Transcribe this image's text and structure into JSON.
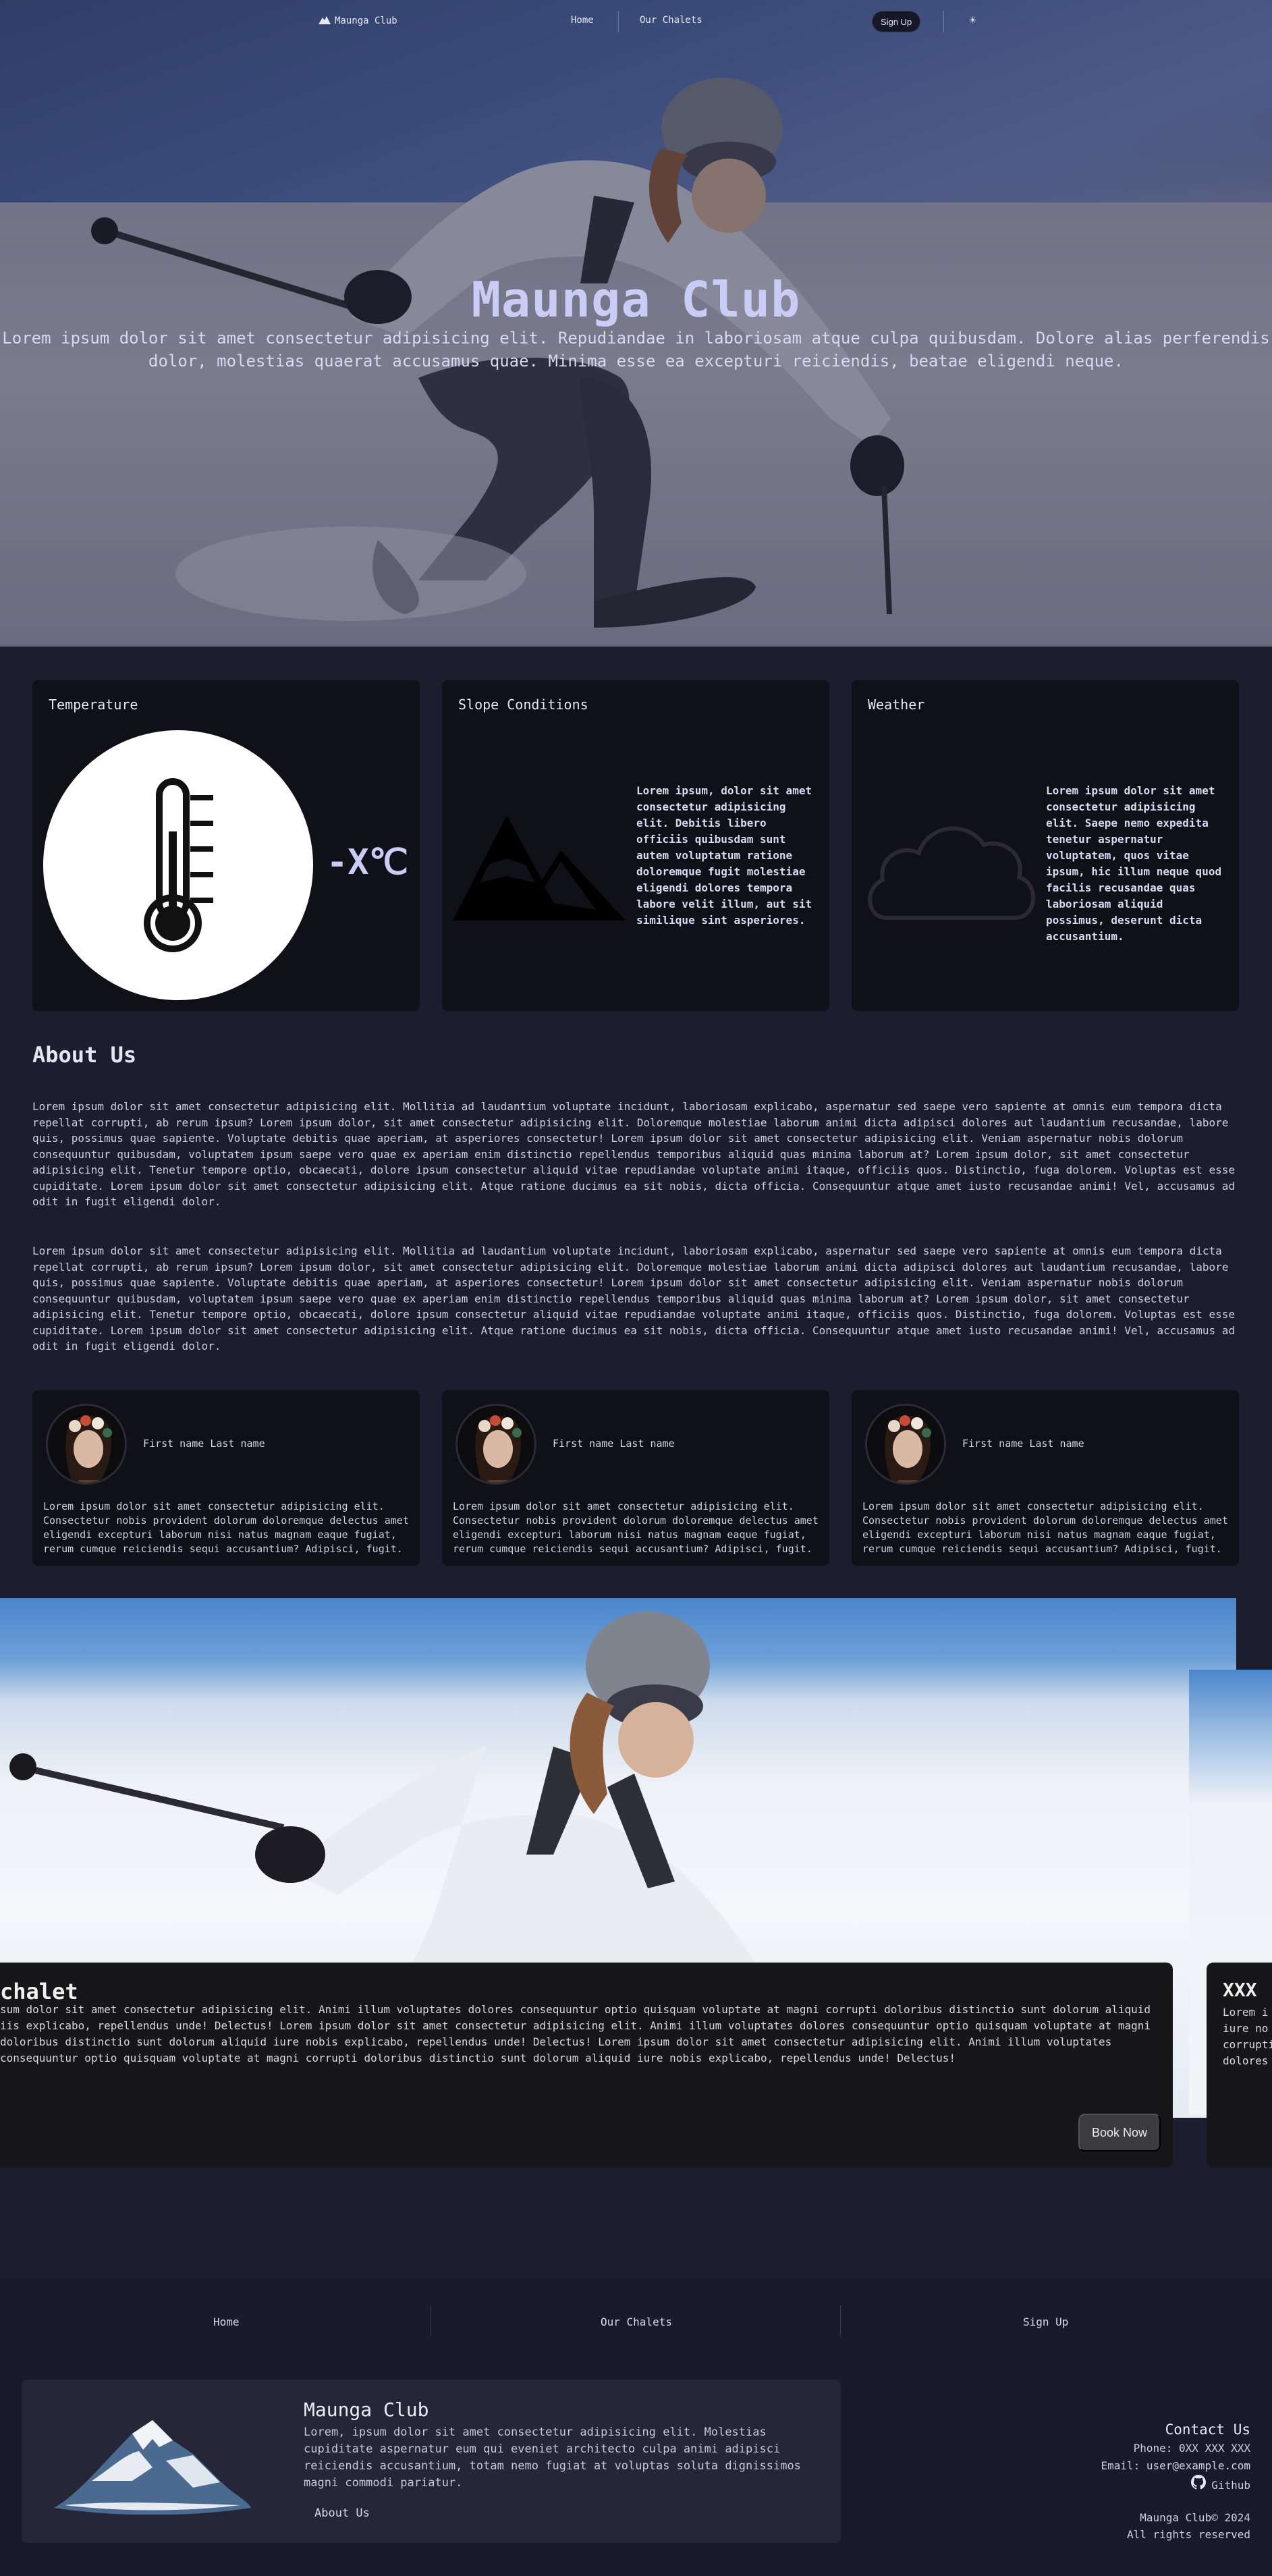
{
  "nav": {
    "logo": "Maunga Club",
    "links": [
      "Home",
      "Our Chalets"
    ],
    "signup": "Sign Up",
    "theme_icon": "sun-icon"
  },
  "hero": {
    "title": "Maunga Club",
    "subtitle_line1": "Lorem ipsum dolor sit amet consectetur adipisicing elit. Repudiandae in laboriosam atque culpa quibusdam. Dolore alias perferendis",
    "subtitle_line2": "dolor, molestias quaerat accusamus quae. Minima esse ea excepturi reiciendis, beatae eligendi neque."
  },
  "cards": {
    "temperature": {
      "title": "Temperature",
      "value": "-X℃",
      "icon": "thermometer-icon"
    },
    "slope": {
      "title": "Slope Conditions",
      "icon": "mountain-icon",
      "text": "Lorem ipsum, dolor sit amet consectetur adipisicing elit. Debitis libero officiis quibusdam sunt autem voluptatum ratione doloremque fugit molestiae eligendi dolores tempora labore velit illum, aut sit similique sint asperiores."
    },
    "weather": {
      "title": "Weather",
      "icon": "cloud-icon",
      "text": "Lorem ipsum dolor sit amet consectetur adipisicing elit. Saepe nemo expedita tenetur aspernatur voluptatem, quos vitae ipsum, hic illum neque quod facilis recusandae quas laboriosam aliquid possimus, deserunt dicta accusantium."
    }
  },
  "about": {
    "title": "About Us",
    "paragraphs": [
      "Lorem ipsum dolor sit amet consectetur adipisicing elit. Mollitia ad laudantium voluptate incidunt, laboriosam explicabo, aspernatur sed saepe vero sapiente at omnis eum tempora dicta repellat corrupti, ab rerum ipsum? Lorem ipsum dolor, sit amet consectetur adipisicing elit. Doloremque molestiae laborum animi dicta adipisci dolores aut laudantium recusandae, labore quis, possimus quae sapiente. Voluptate debitis quae aperiam, at asperiores consectetur! Lorem ipsum dolor sit amet consectetur adipisicing elit. Veniam aspernatur nobis dolorum consequuntur quibusdam, voluptatem ipsum saepe vero quae ex aperiam enim distinctio repellendus temporibus aliquid quas minima laborum at? Lorem ipsum dolor, sit amet consectetur adipisicing elit. Tenetur tempore optio, obcaecati, dolore ipsum consectetur aliquid vitae repudiandae voluptate animi itaque, officiis quos. Distinctio, fuga dolorem. Voluptas est esse cupiditate. Lorem ipsum dolor sit amet consectetur adipisicing elit. Atque ratione ducimus ea sit nobis, dicta officia. Consequuntur atque amet iusto recusandae animi! Vel, accusamus ad odit in fugit eligendi dolor.",
      "Lorem ipsum dolor sit amet consectetur adipisicing elit. Mollitia ad laudantium voluptate incidunt, laboriosam explicabo, aspernatur sed saepe vero sapiente at omnis eum tempora dicta repellat corrupti, ab rerum ipsum? Lorem ipsum dolor, sit amet consectetur adipisicing elit. Doloremque molestiae laborum animi dicta adipisci dolores aut laudantium recusandae, labore quis, possimus quae sapiente. Voluptate debitis quae aperiam, at asperiores consectetur! Lorem ipsum dolor sit amet consectetur adipisicing elit. Veniam aspernatur nobis dolorum consequuntur quibusdam, voluptatem ipsum saepe vero quae ex aperiam enim distinctio repellendus temporibus aliquid quas minima laborum at? Lorem ipsum dolor, sit amet consectetur adipisicing elit. Tenetur tempore optio, obcaecati, dolore ipsum consectetur aliquid vitae repudiandae voluptate animi itaque, officiis quos. Distinctio, fuga dolorem. Voluptas est esse cupiditate. Lorem ipsum dolor sit amet consectetur adipisicing elit. Atque ratione ducimus ea sit nobis, dicta officia. Consequuntur atque amet iusto recusandae animi! Vel, accusamus ad odit in fugit eligendi dolor."
    ]
  },
  "team": [
    {
      "name": "First name Last name",
      "text": "Lorem ipsum dolor sit amet consectetur adipisicing elit. Consectetur nobis provident dolorum doloremque delectus amet eligendi excepturi laborum nisi natus magnam eaque fugiat, rerum cumque reiciendis sequi accusantium? Adipisci, fugit."
    },
    {
      "name": "First name Last name",
      "text": "Lorem ipsum dolor sit amet consectetur adipisicing elit. Consectetur nobis provident dolorum doloremque delectus amet eligendi excepturi laborum nisi natus magnam eaque fugiat, rerum cumque reiciendis sequi accusantium? Adipisci, fugit."
    },
    {
      "name": "First name Last name",
      "text": "Lorem ipsum dolor sit amet consectetur adipisicing elit. Consectetur nobis provident dolorum doloremque delectus amet eligendi excepturi laborum nisi natus magnam eaque fugiat, rerum cumque reiciendis sequi accusantium? Adipisci, fugit."
    }
  ],
  "chalets": {
    "first": {
      "name": "chalet",
      "lines": [
        "sum dolor sit amet consectetur adipisicing elit. Animi illum voluptates dolores consequuntur optio quisquam voluptate at magni corrupti doloribus distinctio sunt dolorum aliquid",
        "iis explicabo, repellendus unde! Delectus! Lorem ipsum dolor sit amet consectetur adipisicing elit. Animi illum voluptates dolores consequuntur optio quisquam voluptate at magni",
        "doloribus distinctio sunt dolorum aliquid iure nobis explicabo, repellendus unde! Delectus! Lorem ipsum dolor sit amet consectetur adipisicing elit. Animi illum voluptates",
        "consequuntur optio quisquam voluptate at magni corrupti doloribus distinctio sunt dolorum aliquid iure nobis explicabo, repellendus unde! Delectus!"
      ],
      "book": "Book Now"
    },
    "second": {
      "name": "XXX",
      "lines": [
        "Lorem i",
        "iure no",
        "corrupti",
        "dolores"
      ]
    }
  },
  "footer": {
    "nav": [
      "Home",
      "Our Chalets",
      "Sign Up"
    ],
    "card_title": "Maunga Club",
    "card_text": "Lorem, ipsum dolor sit amet consectetur adipisicing elit. Molestias cupiditate aspernatur eum qui eveniet architecto culpa animi adipisci reiciendis accusantium, totam nemo fugiat at voluptas soluta dignissimos magni commodi pariatur.",
    "card_link": "About Us",
    "contact_title": "Contact Us",
    "phone": "Phone: 0XX XXX XXX",
    "email": "Email: user@example.com",
    "github": "Github",
    "copyright": "Maunga Club© 2024",
    "rights": "All rights reserved"
  },
  "colors": {
    "page_bg": "#1e1d2f",
    "card_bg": "#101018",
    "accent_title": "#c9ccf4",
    "footer_bg": "#1a1a2c"
  }
}
